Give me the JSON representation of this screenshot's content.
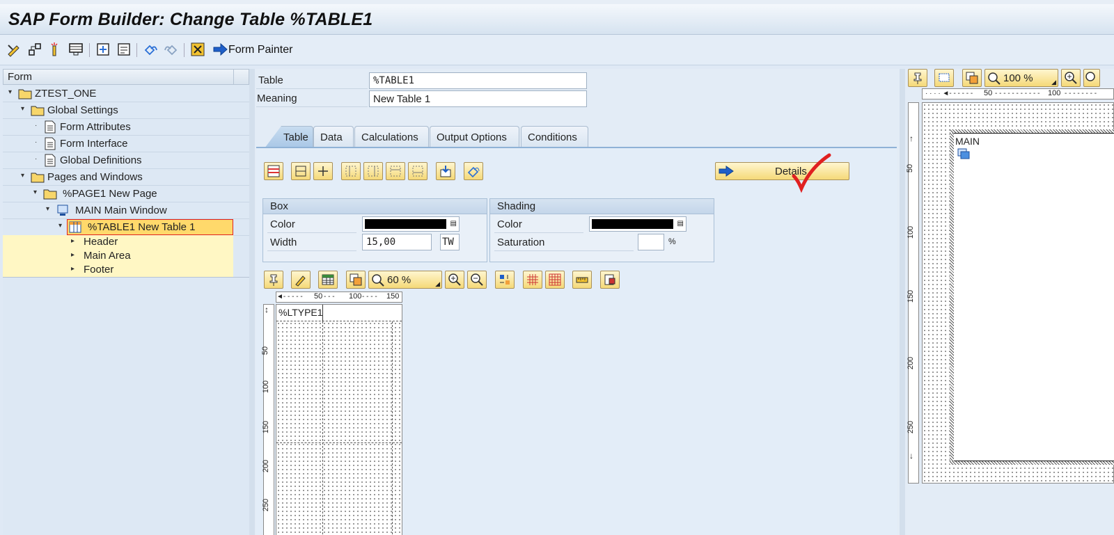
{
  "window": {
    "title": "SAP Form Builder: Change Table %TABLE1"
  },
  "toolbar": {
    "form_painter_label": "Form Painter"
  },
  "tree": {
    "header": "Form",
    "nodes": [
      {
        "label": "ZTEST_ONE"
      },
      {
        "label": "Global Settings"
      },
      {
        "label": "Form Attributes"
      },
      {
        "label": "Form Interface"
      },
      {
        "label": "Global Definitions"
      },
      {
        "label": "Pages and Windows"
      },
      {
        "label": "%PAGE1 New Page"
      },
      {
        "label": "MAIN Main Window"
      },
      {
        "label": "%TABLE1 New Table 1"
      }
    ],
    "sub_nodes": [
      {
        "label": "Header"
      },
      {
        "label": "Main Area"
      },
      {
        "label": "Footer"
      }
    ]
  },
  "fields": {
    "table_label": "Table",
    "table_value": "%TABLE1",
    "meaning_label": "Meaning",
    "meaning_value": "New Table 1"
  },
  "tabs": [
    "Table",
    "Data",
    "Calculations",
    "Output Options",
    "Conditions"
  ],
  "details_button": "Details",
  "box": {
    "title": "Box",
    "color_label": "Color",
    "width_label": "Width",
    "width_value": "15,00",
    "width_unit": "TW"
  },
  "shading": {
    "title": "Shading",
    "color_label": "Color",
    "saturation_label": "Saturation",
    "saturation_unit": "%"
  },
  "table_painter": {
    "zoom": "60 %",
    "ruler_h": [
      "50",
      "100",
      "150"
    ],
    "ruler_v": [
      "50",
      "100",
      "150",
      "200",
      "250"
    ],
    "line_type": "%LTYPE1"
  },
  "form_painter": {
    "zoom": "100 %",
    "ruler_h": [
      "50",
      "100"
    ],
    "ruler_v": [
      "50",
      "100",
      "150",
      "200",
      "250"
    ],
    "window_label": "MAIN"
  },
  "colors": {
    "button_yellow": "#f5d978",
    "selected_row": "#ffd96b",
    "sub_rows": "#fff7c4",
    "accent_red": "#e02020"
  }
}
